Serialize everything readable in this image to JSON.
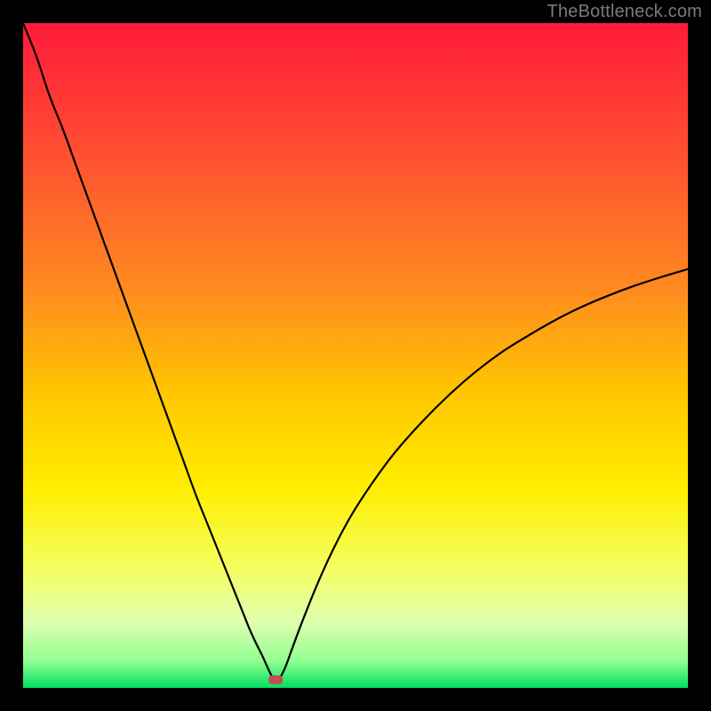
{
  "watermark": "TheBottleneck.com",
  "chart_data": {
    "type": "line",
    "title": "",
    "xlabel": "",
    "ylabel": "",
    "xlim": [
      0,
      100
    ],
    "ylim": [
      0,
      100
    ],
    "background_gradient": {
      "stops": [
        {
          "offset": 0.0,
          "color": "#ff1a3a"
        },
        {
          "offset": 0.2,
          "color": "#ff5030"
        },
        {
          "offset": 0.4,
          "color": "#ff8a20"
        },
        {
          "offset": 0.55,
          "color": "#ffc400"
        },
        {
          "offset": 0.7,
          "color": "#ffee00"
        },
        {
          "offset": 0.82,
          "color": "#f4ff60"
        },
        {
          "offset": 0.9,
          "color": "#e0ffb0"
        },
        {
          "offset": 0.96,
          "color": "#90ff90"
        },
        {
          "offset": 1.0,
          "color": "#00e060"
        }
      ]
    },
    "marker": {
      "x": 38,
      "y": 1.2,
      "color": "#c0504d"
    },
    "series": [
      {
        "name": "curve",
        "x": [
          0,
          2,
          4,
          6,
          8,
          10,
          12,
          14,
          16,
          18,
          20,
          22,
          24,
          26,
          28,
          30,
          32,
          33,
          34,
          35,
          36,
          36.8,
          37.4,
          38.0,
          38.8,
          39.6,
          40.5,
          42,
          44,
          46,
          48,
          50,
          53,
          56,
          60,
          64,
          68,
          72,
          76,
          80,
          84,
          88,
          92,
          96,
          100
        ],
        "values": [
          100,
          95,
          89,
          84,
          78.5,
          73,
          67.5,
          62,
          56.5,
          51,
          45.5,
          40,
          34.5,
          29,
          24,
          19,
          14,
          11.5,
          9,
          6.8,
          4.8,
          3.0,
          1.8,
          1.0,
          1.8,
          3.5,
          6.0,
          10,
          15,
          19.5,
          23.5,
          27,
          31.5,
          35.5,
          40,
          44,
          47.5,
          50.5,
          53,
          55.3,
          57.3,
          59,
          60.5,
          61.8,
          63
        ]
      }
    ]
  }
}
